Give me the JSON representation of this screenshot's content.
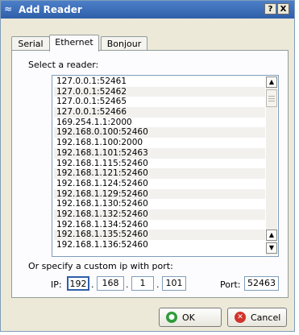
{
  "window": {
    "title": "Add Reader",
    "help_label": "?",
    "close_label": "X"
  },
  "tabs": [
    {
      "label": "Serial",
      "active": false
    },
    {
      "label": "Ethernet",
      "active": true
    },
    {
      "label": "Bonjour",
      "active": false
    }
  ],
  "select_label": "Select a reader:",
  "readers": [
    "127.0.0.1:52461",
    "127.0.0.1:52462",
    "127.0.0.1:52465",
    "127.0.0.1:52466",
    "169.254.1.1:2000",
    "192.168.0.100:52460",
    "192.168.1.100:2000",
    "192.168.1.101:52463",
    "192.168.1.115:52460",
    "192.168.1.121:52460",
    "192.168.1.124:52460",
    "192.168.1.129:52460",
    "192.168.1.130:52460",
    "192.168.1.132:52460",
    "192.168.1.134:52460",
    "192.168.1.135:52460",
    "192.168.1.136:52460"
  ],
  "custom_label": "Or specify a custom ip with port:",
  "ip": {
    "label": "IP:",
    "octets": [
      "192",
      "168",
      "1",
      "101"
    ]
  },
  "port": {
    "label": "Port:",
    "value": "52463"
  },
  "buttons": {
    "ok": "OK",
    "cancel": "Cancel"
  },
  "colors": {
    "title_bar": "#2f5fa8",
    "ok_icon": "#2e9b3a",
    "cancel_icon": "#d0342c"
  }
}
